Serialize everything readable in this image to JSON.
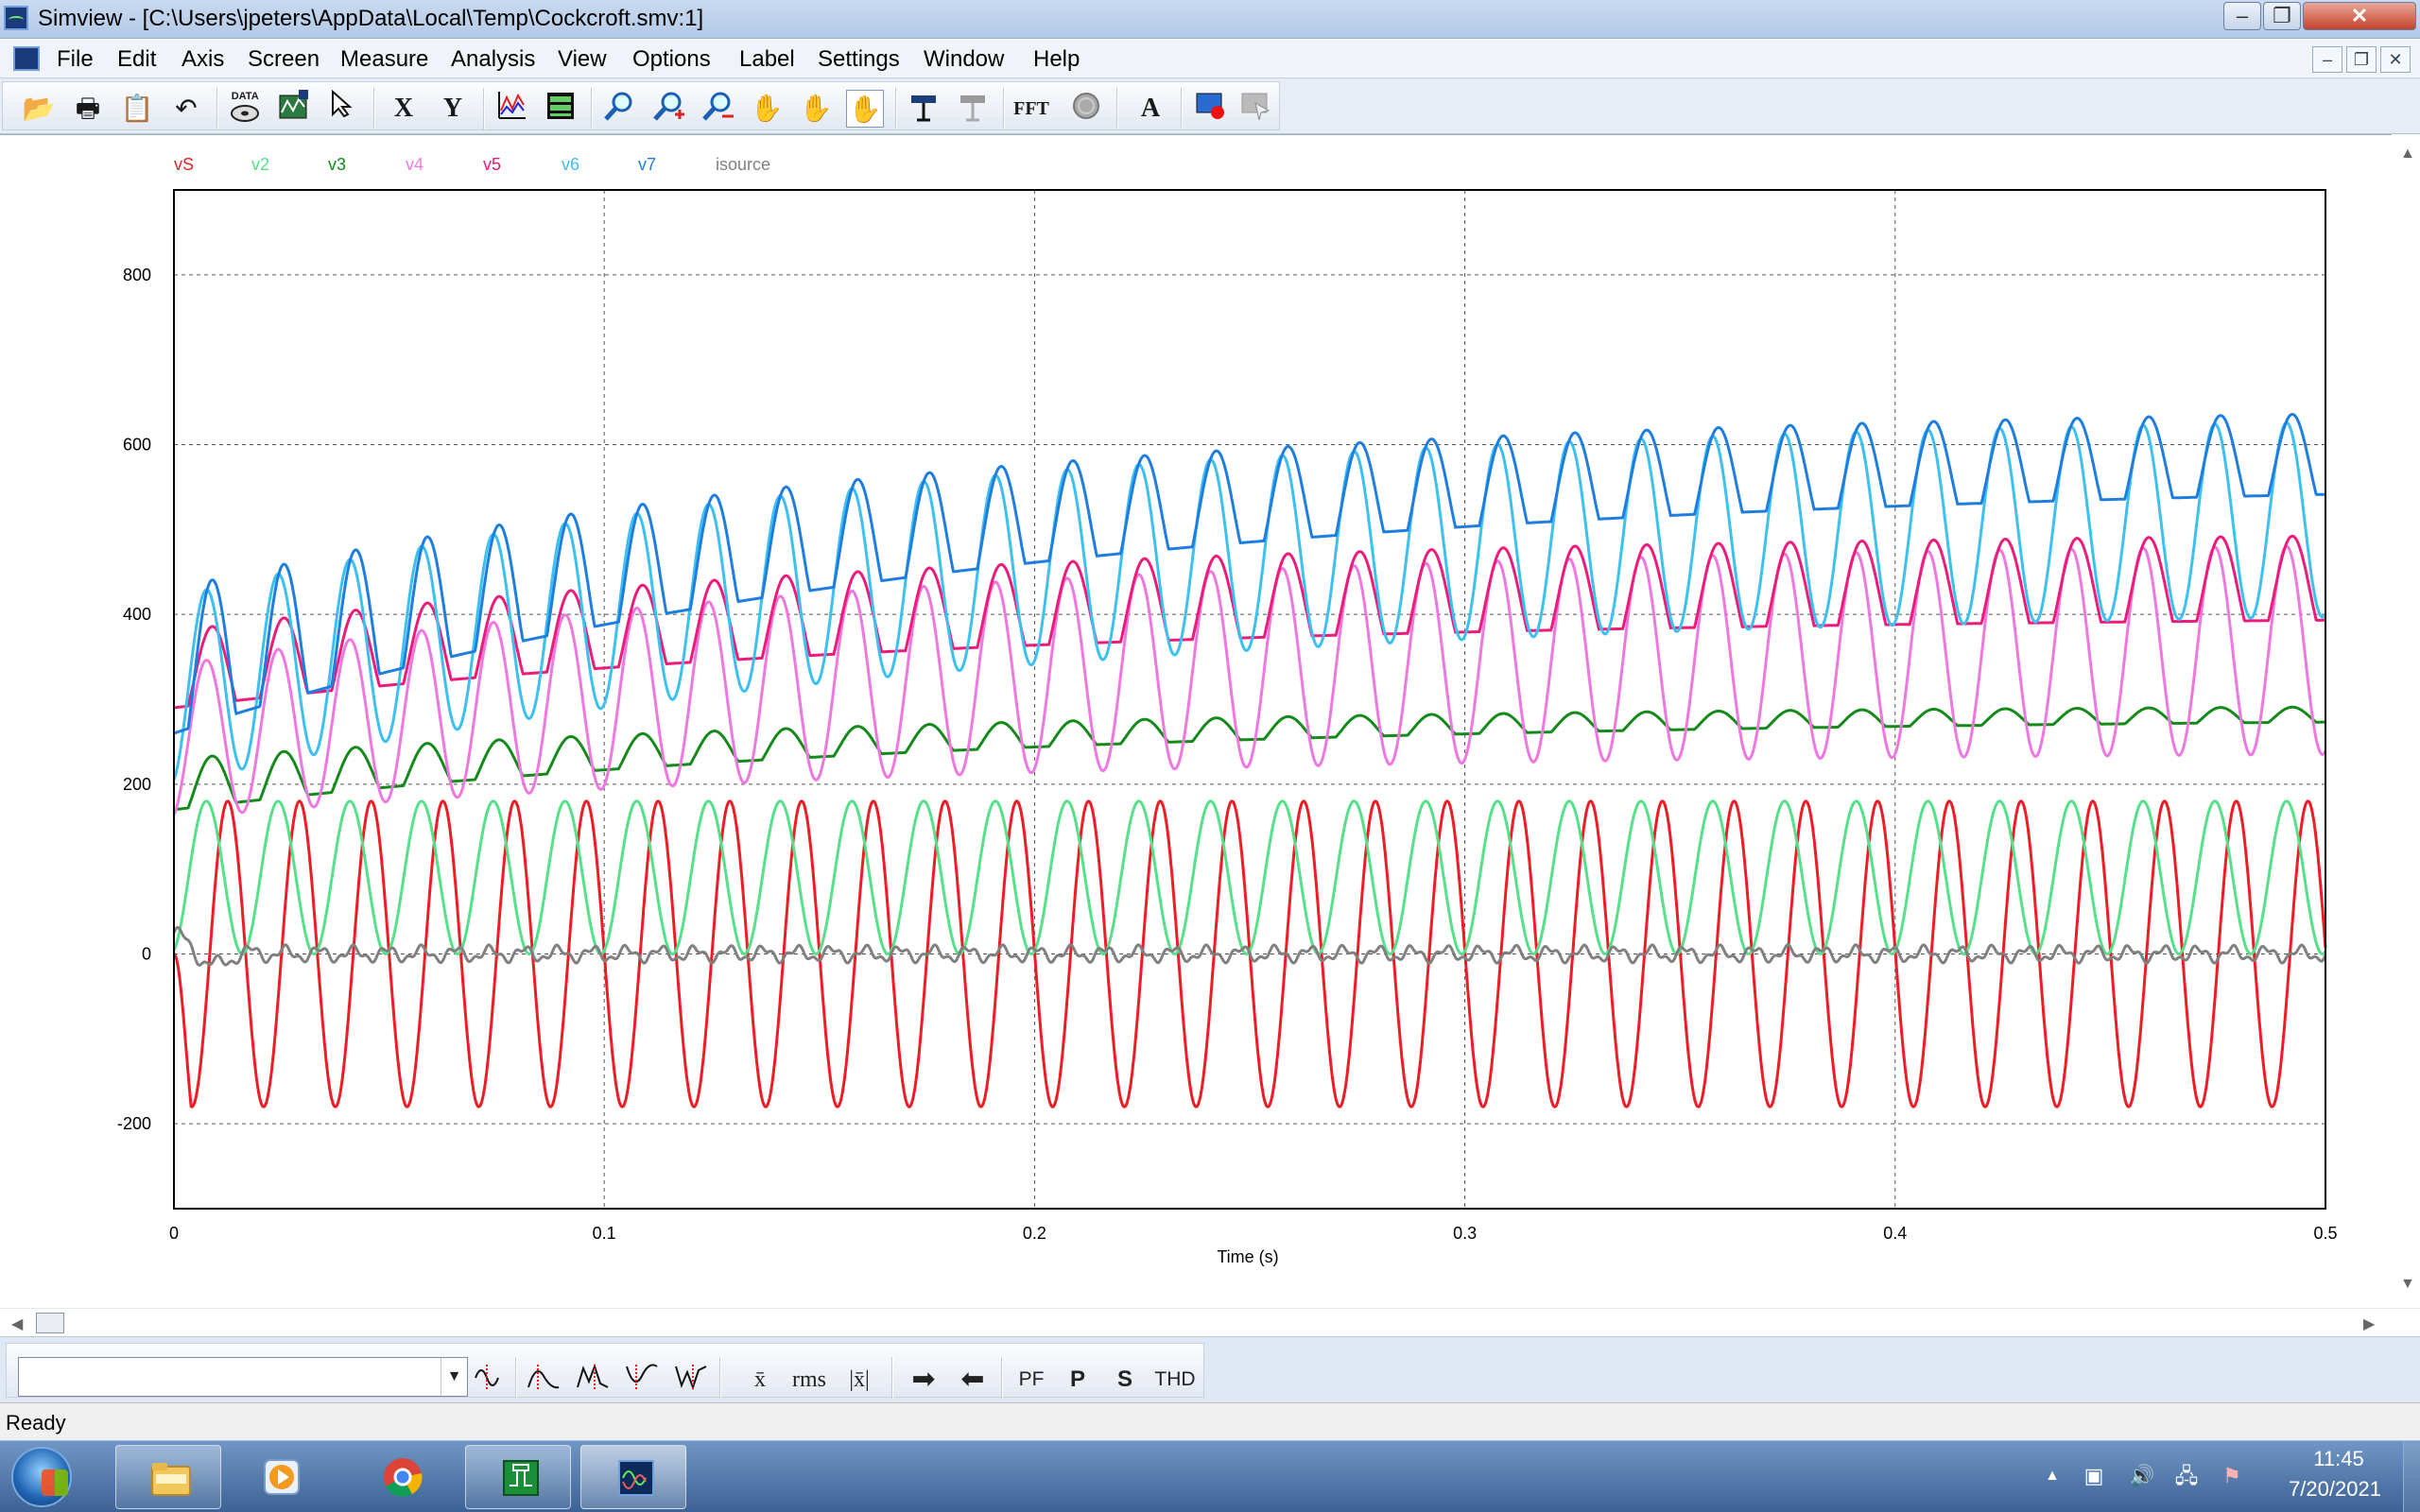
{
  "window": {
    "title": "Simview - [C:\\Users\\jpeters\\AppData\\Local\\Temp\\Cockcroft.smv:1]",
    "min_glyph": "–",
    "max_glyph": "❐",
    "close_glyph": "✕"
  },
  "menu": {
    "items": [
      "File",
      "Edit",
      "Axis",
      "Screen",
      "Measure",
      "Analysis",
      "View",
      "Options",
      "Label",
      "Settings",
      "Window",
      "Help"
    ],
    "mdi_min": "–",
    "mdi_restore": "❐",
    "mdi_close": "✕"
  },
  "toolbar": {
    "open": "📂",
    "print": "🖶",
    "clipboard": "📋",
    "undo": "↶",
    "data_label": "DATA",
    "x_label": "X",
    "y_label": "Y",
    "fft_label": "FFT",
    "text_label": "A"
  },
  "chart_data": {
    "type": "line",
    "xlabel": "Time (s)",
    "xlim": [
      0,
      0.5
    ],
    "ylim": [
      -300,
      900
    ],
    "xticks": [
      0,
      0.1,
      0.2,
      0.3,
      0.4,
      0.5
    ],
    "xtick_labels": [
      "0",
      "0.1",
      "0.2",
      "0.3",
      "0.4",
      "0.5"
    ],
    "yticks": [
      -200,
      0,
      200,
      400,
      600,
      800
    ],
    "ytick_labels": [
      "-200",
      "0",
      "200",
      "400",
      "600",
      "800"
    ],
    "grid": true,
    "legend_position": "top-left",
    "period_s": 0.01667,
    "series": [
      {
        "name": "vS",
        "color": "#ee1c24",
        "kind": "sine",
        "offset": 0,
        "amplitude": 180,
        "settle_value": [
          0,
          0
        ]
      },
      {
        "name": "v2",
        "color": "#56e08a",
        "kind": "stage",
        "low": 0,
        "high": 180,
        "early": [
          0,
          0
        ],
        "late": [
          0,
          0
        ]
      },
      {
        "name": "v3",
        "color": "#138a1a",
        "kind": "ramp",
        "early": [
          170,
          230
        ],
        "late": [
          280,
          295
        ]
      },
      {
        "name": "v4",
        "color": "#ef78e0",
        "kind": "stage",
        "early": [
          160,
          340
        ],
        "late": [
          240,
          490
        ]
      },
      {
        "name": "v5",
        "color": "#ec1c7a",
        "kind": "ramp",
        "early": [
          290,
          380
        ],
        "late": [
          400,
          500
        ]
      },
      {
        "name": "v6",
        "color": "#3cc0f0",
        "kind": "stage",
        "early": [
          200,
          420
        ],
        "late": [
          410,
          640
        ]
      },
      {
        "name": "v7",
        "color": "#1e7ee0",
        "kind": "ramp",
        "early": [
          260,
          430
        ],
        "late": [
          560,
          650
        ]
      },
      {
        "name": "isource",
        "color": "#808080",
        "kind": "noise",
        "offset": 0,
        "amplitude": 12
      }
    ]
  },
  "measure": {
    "select_value": "",
    "rms_label": "rms",
    "pf_label": "PF",
    "p_label": "P",
    "s_label": "S",
    "thd_label": "THD",
    "avg_label": "x̄",
    "absavg_label": "|x̄|"
  },
  "status": {
    "text": "Ready"
  },
  "taskbar": {
    "time": "11:45",
    "date": "7/20/2021"
  }
}
